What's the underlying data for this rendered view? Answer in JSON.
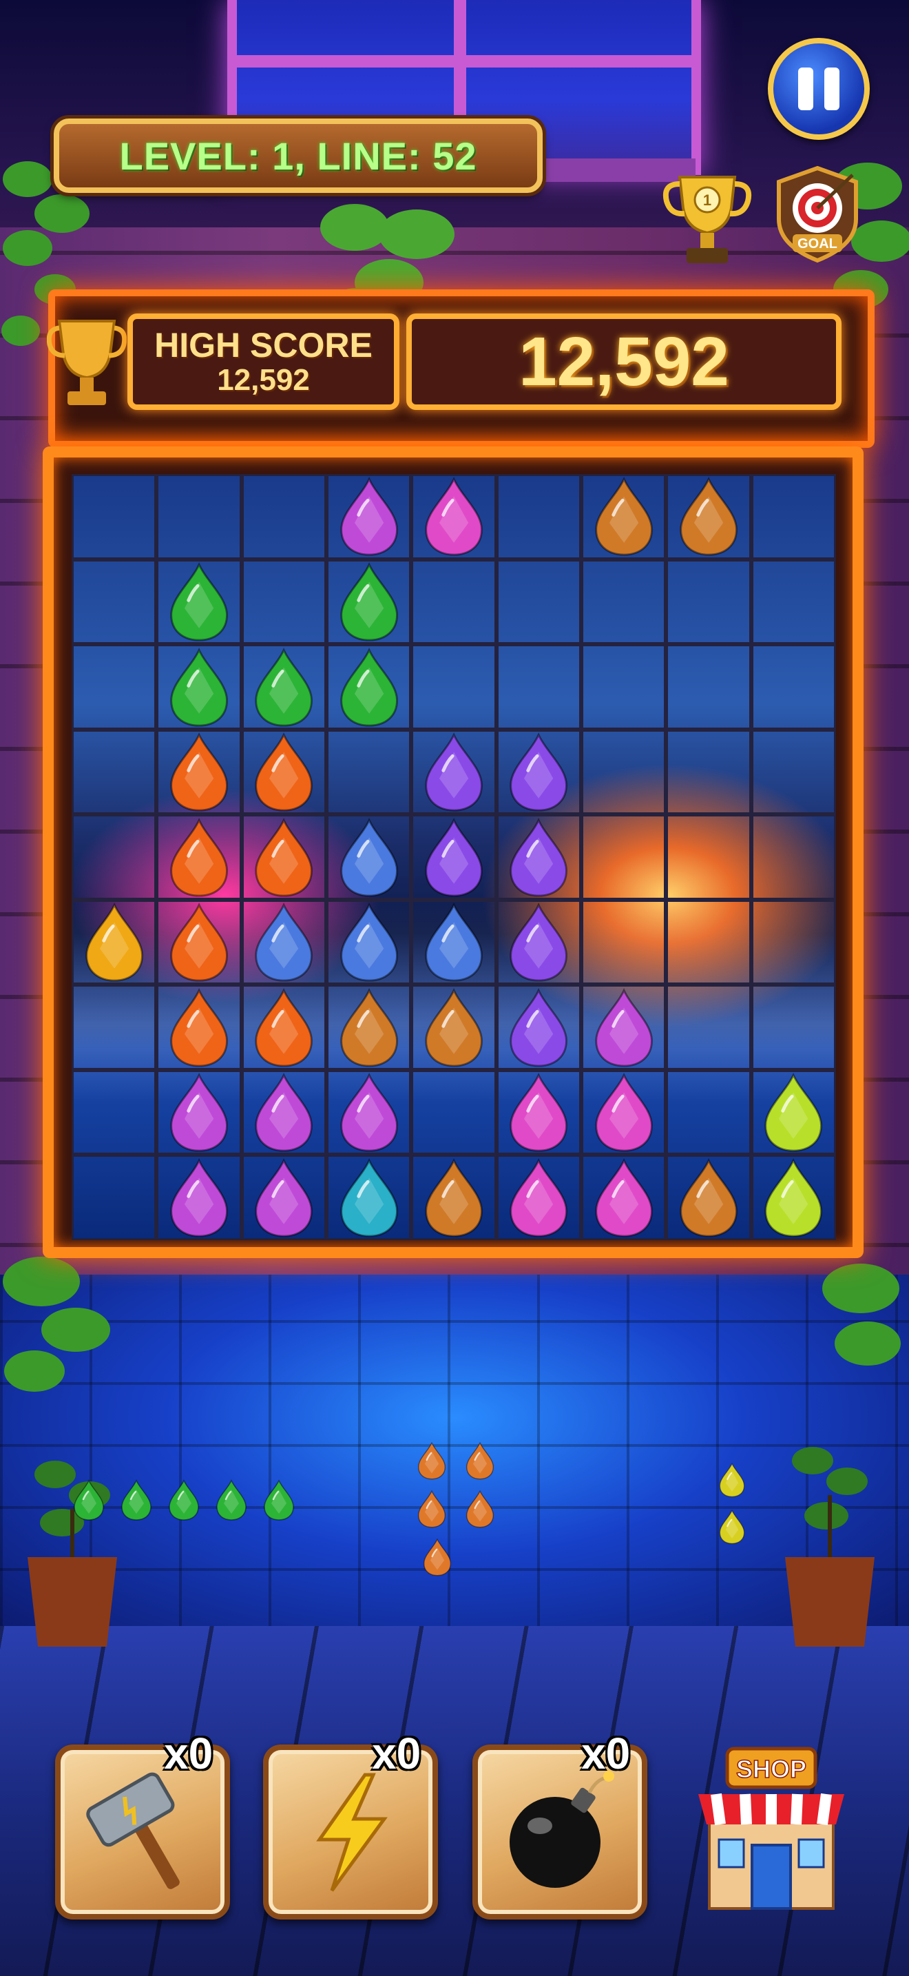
{
  "header": {
    "level_text": "LEVEL: 1, LINE: 52",
    "pause_icon": "pause-icon",
    "trophy_icon": "trophy-icon",
    "goal_label": "GOAL"
  },
  "score": {
    "high_score_label": "HIGH SCORE",
    "high_score_value": "12,592",
    "current_score": "12,592"
  },
  "board": {
    "columns": 9,
    "rows": 9,
    "palette": {
      "P": "#c04ad8",
      "M": "#e04ac8",
      "B": "#d07a28",
      "G": "#2cb436",
      "O": "#f06418",
      "V": "#8a4ae8",
      "L": "#4a7ae0",
      "Y": "#f0a814",
      "T": "#2ab0c8",
      "C": "#b8e02a"
    },
    "grid": [
      "...PM.BB.",
      ".G.G.....",
      ".GGG.....",
      ".OO.VV...",
      ".OOLVV...",
      "YOLLLV...",
      ".OOBBVP..",
      ".PPP.MM.C",
      ".PPTBMMBC"
    ]
  },
  "tray": {
    "pieces": [
      {
        "color": "#2cb436",
        "count": 5
      },
      {
        "color": "#e0782a",
        "count": 5
      },
      {
        "color": "#d8d020",
        "count": 2
      }
    ]
  },
  "powerups": [
    {
      "name": "hammer",
      "icon": "hammer-icon",
      "count": "x0"
    },
    {
      "name": "lightning",
      "icon": "lightning-icon",
      "count": "x0"
    },
    {
      "name": "bomb",
      "icon": "bomb-icon",
      "count": "x0"
    }
  ],
  "shop": {
    "label": "SHOP",
    "icon": "shop-icon"
  }
}
